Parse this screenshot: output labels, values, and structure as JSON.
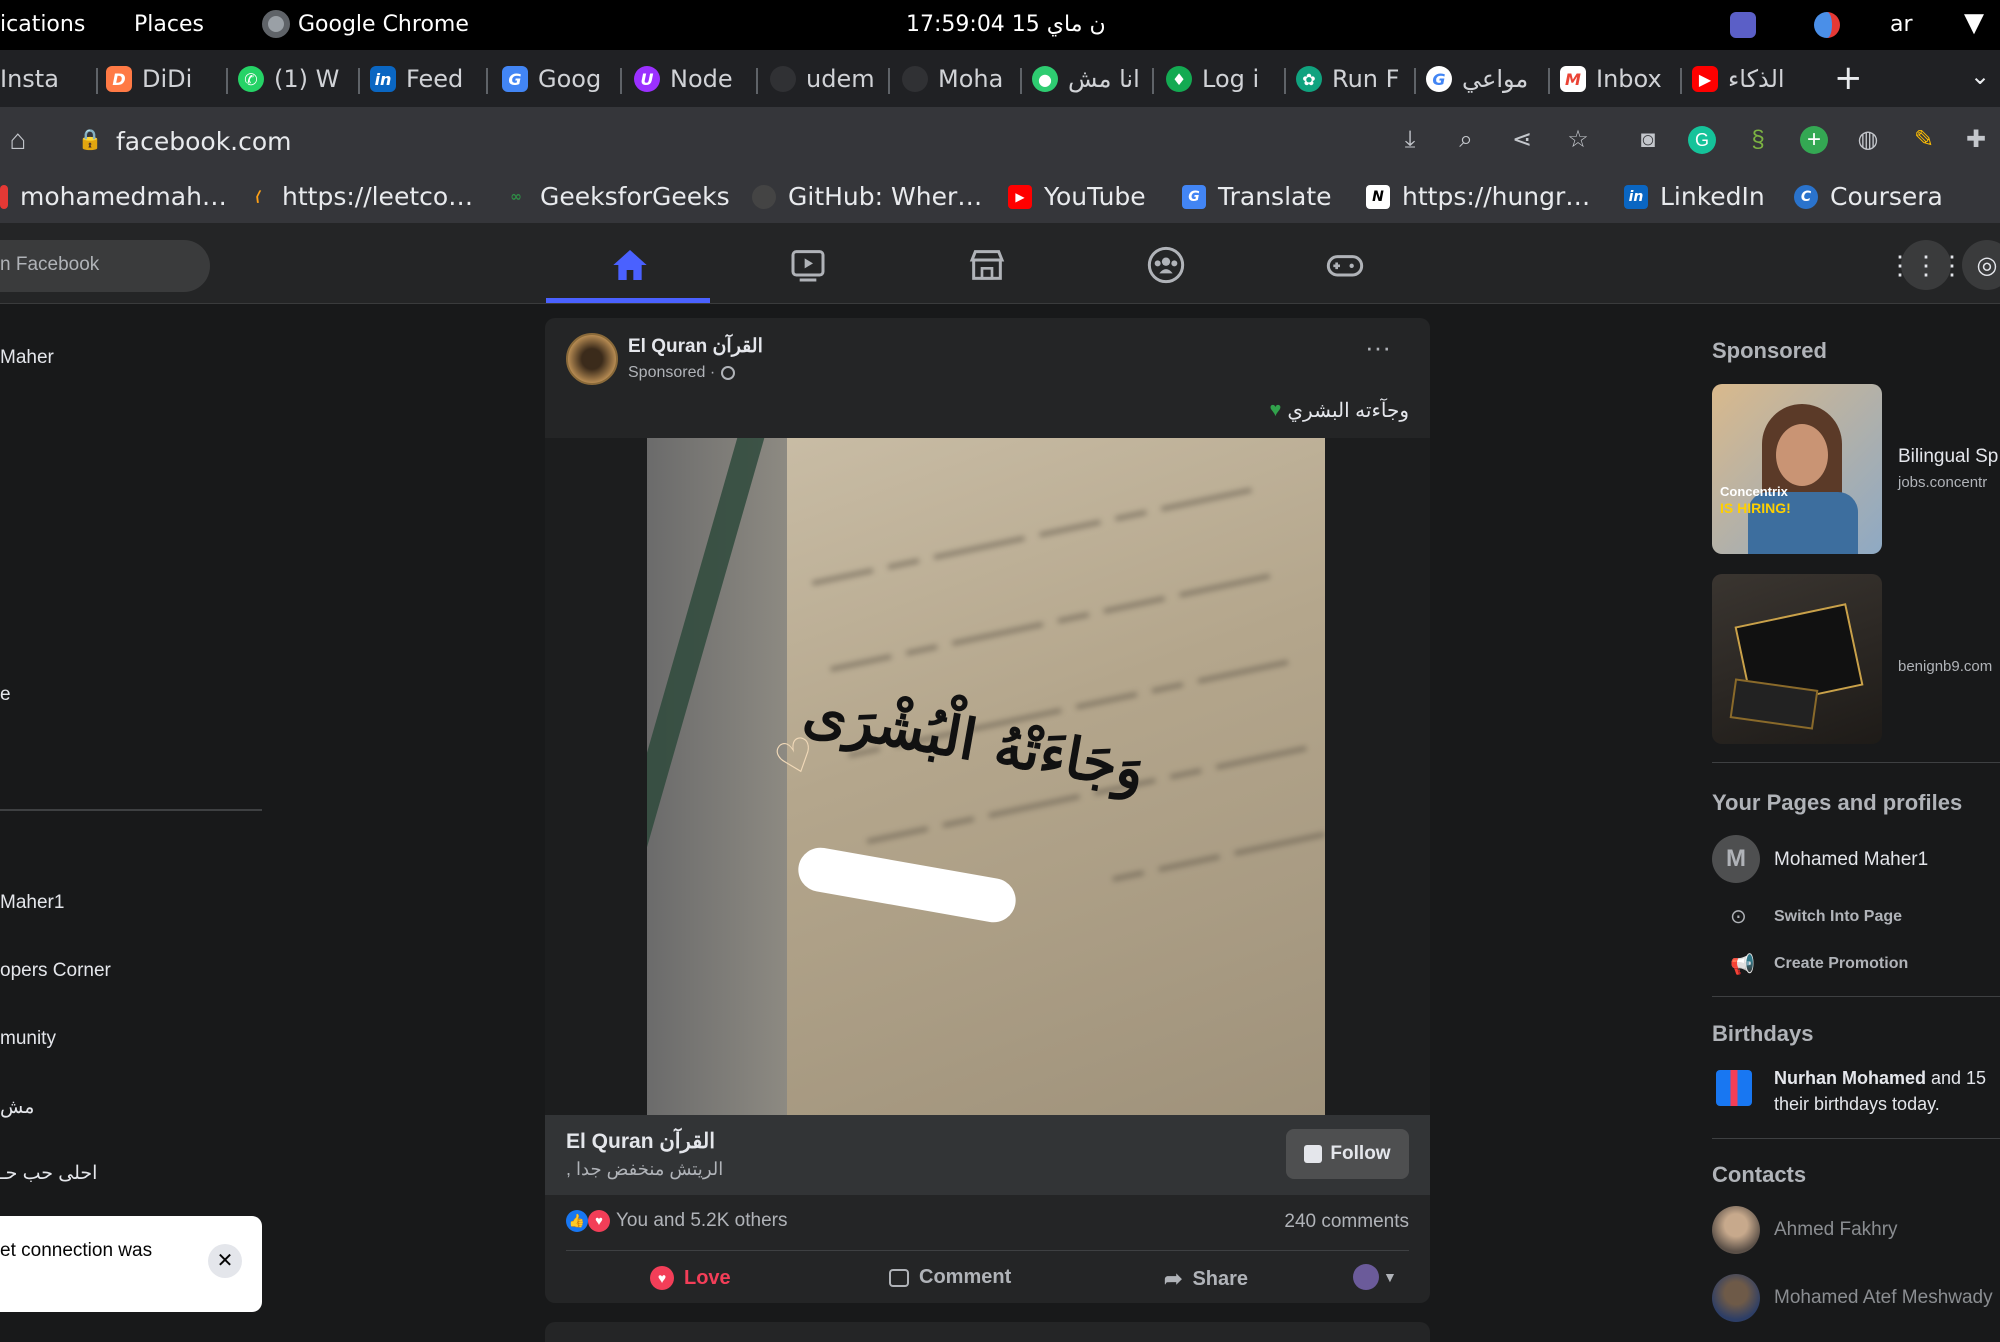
{
  "system_bar": {
    "activities": "ications",
    "places": "Places",
    "app": "Google Chrome",
    "clock": "17:59:04  15 ن ماي",
    "lang": "ar"
  },
  "tabs": [
    {
      "label": "Insta",
      "icon": "instagram-icon",
      "color": "#c13584"
    },
    {
      "label": "DiDi",
      "icon": "didi-icon",
      "color": "#ff7a45"
    },
    {
      "label": "(1) W",
      "icon": "whatsapp-icon",
      "color": "#25d366"
    },
    {
      "label": "Feed",
      "icon": "linkedin-icon",
      "color": "#0a66c2"
    },
    {
      "label": "Goog",
      "icon": "translate-icon",
      "color": "#4285f4"
    },
    {
      "label": "Node",
      "icon": "node-icon",
      "color": "#9b30ff"
    },
    {
      "label": "udem",
      "icon": "github-icon",
      "color": "#24292e"
    },
    {
      "label": "Moha",
      "icon": "github-icon",
      "color": "#24292e"
    },
    {
      "label": "انا مش",
      "icon": "chat-icon",
      "color": "#2ecc71"
    },
    {
      "label": "Log i",
      "icon": "mongodb-icon",
      "color": "#13aa52"
    },
    {
      "label": "Run F",
      "icon": "openai-icon",
      "color": "#10a37f"
    },
    {
      "label": "مواعي",
      "icon": "google-icon",
      "color": "#ffffff"
    },
    {
      "label": "Inbox",
      "icon": "gmail-icon",
      "color": "#ea4335"
    },
    {
      "label": "الذكاء",
      "icon": "youtube-icon",
      "color": "#ff0000"
    }
  ],
  "address": {
    "url": "facebook.com"
  },
  "bookmarks": [
    {
      "label": "mohamedmah…",
      "icon": "bookmark-icon",
      "color": "#e53935"
    },
    {
      "label": "https://leetco…",
      "icon": "leetcode-icon",
      "color": "#ffa116"
    },
    {
      "label": "GeeksforGeeks",
      "icon": "gfg-icon",
      "color": "#2f8d46"
    },
    {
      "label": "GitHub: Wher…",
      "icon": "github-icon",
      "color": "#444"
    },
    {
      "label": "YouTube",
      "icon": "youtube-icon",
      "color": "#ff0000"
    },
    {
      "label": "Translate",
      "icon": "translate-icon",
      "color": "#4285f4"
    },
    {
      "label": "https://hungr…",
      "icon": "notion-icon",
      "color": "#ffffff"
    },
    {
      "label": "LinkedIn",
      "icon": "linkedin-icon",
      "color": "#0a66c2"
    },
    {
      "label": "Coursera",
      "icon": "coursera-icon",
      "color": "#2a73cc"
    }
  ],
  "fb": {
    "search_placeholder": "n Facebook",
    "left_items": [
      "Maher",
      "e"
    ],
    "shortcuts": [
      "Maher1",
      "opers Corner",
      "munity",
      "مش",
      "احلى حب حـ"
    ],
    "toast": "et connection was"
  },
  "post": {
    "page_name": "El Quran القرآن",
    "sponsored": "Sponsored ·",
    "caption": "وجآءته البشري",
    "image_text": "وَجَاءَتْهُ الْبُشْرَى",
    "cta_title": "El Quran القرآن",
    "cta_sub": "الريتش منخفض جدا ,",
    "follow": "Follow",
    "reactions": "You and 5.2K others",
    "comments": "240 comments",
    "love": "Love",
    "comment": "Comment",
    "share": "Share"
  },
  "right": {
    "sponsored_title": "Sponsored",
    "ads": [
      {
        "title": "Bilingual Sp",
        "domain": "jobs.concentr",
        "badge1": "Concentrix",
        "badge2": "IS HIRING!"
      },
      {
        "title": "",
        "domain": "benignb9.com"
      }
    ],
    "pages_title": "Your Pages and profiles",
    "profile_name": "Mohamed Maher1",
    "avatar_letter": "M",
    "switch": "Switch Into Page",
    "promo": "Create Promotion",
    "birthdays_title": "Birthdays",
    "bday_name": "Nurhan Mohamed",
    "bday_and": " and 15",
    "bday_rest": "their birthdays today.",
    "contacts_title": "Contacts",
    "contacts": [
      "Ahmed Fakhry",
      "Mohamed Atef Meshwady"
    ]
  },
  "colors": {
    "accent": "#4a61ff",
    "love": "#f33e58"
  }
}
